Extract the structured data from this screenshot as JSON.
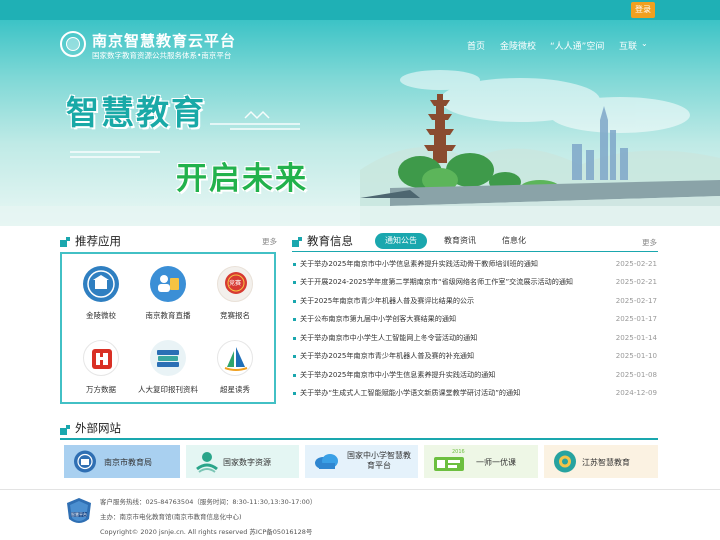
{
  "header": {
    "login_label": "登录",
    "brand_title": "南京智慧教育云平台",
    "brand_subtitle": "国家数字教育资源公共服务体系•南京平台",
    "nav": [
      "首页",
      "金陵微校",
      "“人人通”空间",
      "互联"
    ]
  },
  "banner": {
    "slogan_line1": "智慧教育",
    "slogan_line2": "开启未来"
  },
  "apps": {
    "title": "推荐应用",
    "more_label": "更多",
    "items": [
      {
        "label": "金陵微校",
        "icon": "jinling-weixiao-icon"
      },
      {
        "label": "南京教育直播",
        "icon": "live-broadcast-icon"
      },
      {
        "label": "竞赛报名",
        "icon": "competition-badge-icon"
      },
      {
        "label": "万方数据",
        "icon": "wanfang-icon"
      },
      {
        "label": "人大复印报刊资料",
        "icon": "books-stack-icon"
      },
      {
        "label": "超星读秀",
        "icon": "chaoxing-sail-icon"
      }
    ],
    "badge_text": "竞赛"
  },
  "news": {
    "title": "教育信息",
    "more_label": "更多",
    "tabs": [
      "通知公告",
      "教育资讯",
      "信息化"
    ],
    "active_tab": 0,
    "items": [
      {
        "title": "关于举办2025年南京市中小学信息素养提升实践活动骨干教师培训班的通知",
        "date": "2025-02-21"
      },
      {
        "title": "关于开展2024-2025学年度第二学期南京市“省级网络名师工作室”交流展示活动的通知",
        "date": "2025-02-21"
      },
      {
        "title": "关于2025年南京市青少年机器人普及赛评比结果的公示",
        "date": "2025-02-17"
      },
      {
        "title": "关于公布南京市第九届中小学创客大赛结果的通知",
        "date": "2025-01-17"
      },
      {
        "title": "关于举办南京市中小学生人工智能网上冬令营活动的通知",
        "date": "2025-01-14"
      },
      {
        "title": "关于举办2025年南京市青少年机器人普及赛的补充通知",
        "date": "2025-01-10"
      },
      {
        "title": "关于举办2025年南京市中小学生信息素养提升实践活动的通知",
        "date": "2025-01-08"
      },
      {
        "title": "关于举办“生成式人工智能赋能小学语文新质课堂教学研讨活动”的通知",
        "date": "2024-12-09"
      }
    ]
  },
  "external": {
    "title": "外部网站",
    "items": [
      {
        "label": "南京市教育局",
        "icon": "nanjing-education-bureau-icon",
        "bg": "#a9d0f0"
      },
      {
        "label": "国家数字资源",
        "icon": "national-digital-resource-icon",
        "bg": "#e4f6f3"
      },
      {
        "label": "国家中小学智慧教育平台",
        "icon": "cloud-platform-icon",
        "bg": "#e5f2fb"
      },
      {
        "label": "一师一优课",
        "icon": "one-teacher-one-lesson-icon",
        "bg": "#eef7e6"
      },
      {
        "label": "江苏智慧教育",
        "icon": "jiangsu-smart-education-icon",
        "bg": "#fbf2e2"
      }
    ],
    "badge_2016": "2016"
  },
  "footer": {
    "hotline": "客户服务热线：025-84763504（服务时间：8:30-11:30,13:30-17:00）",
    "sponsor": "主办：南京市电化教育馆(南京市教育信息化中心)",
    "copyright": "Copyright© 2020 jsnje.cn. All rights reserved    苏ICP备05016128号",
    "logo_text": "智慧平台"
  },
  "colors": {
    "teal": "#1aa7ae",
    "topbar": "#1fb0b5",
    "login": "#f0a020",
    "slogan1": "#19a9a7",
    "slogan2": "#22b24c"
  }
}
